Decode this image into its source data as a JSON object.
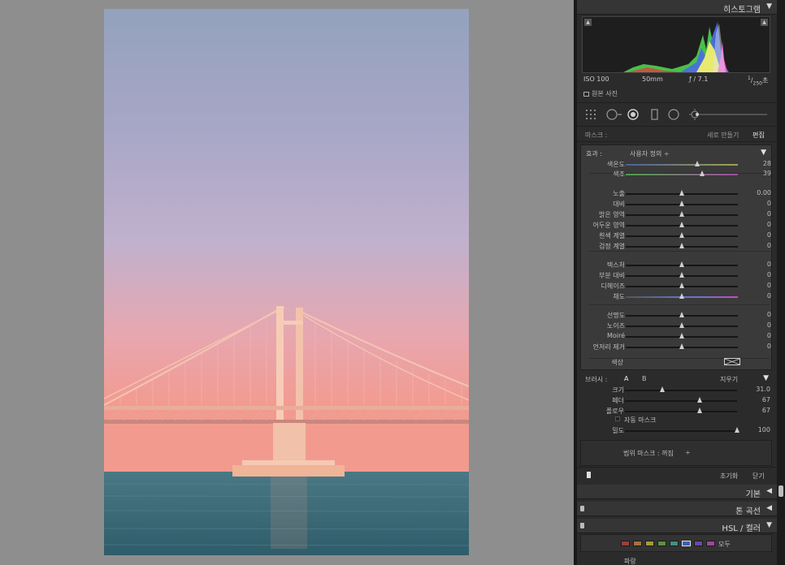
{
  "histogram": {
    "title": "히스토그램",
    "iso": "ISO 100",
    "focal": "50mm",
    "aperture": "ƒ / 7.1",
    "shutter_num": "1",
    "shutter_den": "250",
    "shutter_unit": "초",
    "original_photo": "원본 사진"
  },
  "mask": {
    "label": "마스크 :",
    "new_label": "새로 만들기",
    "edit_label": "편집"
  },
  "effect": {
    "label": "효과 :",
    "preset": "사용자 정의 ÷",
    "rows": [
      {
        "label": "색온도",
        "value": "28",
        "pos": 0.64
      },
      {
        "label": "색조",
        "value": "39",
        "pos": 0.68
      },
      {
        "label": "노출",
        "value": "0.00",
        "pos": 0.5
      },
      {
        "label": "대비",
        "value": "0",
        "pos": 0.5
      },
      {
        "label": "밝은 영역",
        "value": "0",
        "pos": 0.5
      },
      {
        "label": "어두운 영역",
        "value": "0",
        "pos": 0.5
      },
      {
        "label": "흰색 계열",
        "value": "0",
        "pos": 0.5
      },
      {
        "label": "검정 계열",
        "value": "0",
        "pos": 0.5
      },
      {
        "label": "텍스처",
        "value": "0",
        "pos": 0.5
      },
      {
        "label": "부분 대비",
        "value": "0",
        "pos": 0.5
      },
      {
        "label": "디헤이즈",
        "value": "0",
        "pos": 0.5
      },
      {
        "label": "채도",
        "value": "0",
        "pos": 0.5
      },
      {
        "label": "선명도",
        "value": "0",
        "pos": 0.5
      },
      {
        "label": "노이즈",
        "value": "0",
        "pos": 0.5
      },
      {
        "label": "Moiré",
        "value": "0",
        "pos": 0.5
      },
      {
        "label": "언저리 제거",
        "value": "0",
        "pos": 0.5
      }
    ],
    "color_label": "색상"
  },
  "brush": {
    "label": "브러시 :",
    "a": "A",
    "b": "B",
    "erase": "지우기",
    "rows": [
      {
        "label": "크기",
        "value": "31.0",
        "pos": 0.33
      },
      {
        "label": "페더",
        "value": "67",
        "pos": 0.67
      },
      {
        "label": "플로우",
        "value": "67",
        "pos": 0.67
      }
    ],
    "auto_mask": "자동 마스크",
    "density_label": "밀도",
    "density_value": "100",
    "density_pos": 1.0,
    "range_mask": "범위 마스크 : 꺼짐",
    "range_arrow": "÷",
    "reset": "초기화",
    "close": "닫기"
  },
  "panels": {
    "basic": "기본",
    "tone_curve": "톤 곡선",
    "hsl": "HSL / 컬러",
    "all": "모두",
    "blue": "파랑"
  },
  "hsl_swatches": [
    "#a43b3b",
    "#a8703a",
    "#a29a3a",
    "#5e8f3f",
    "#3f8f86",
    "#3c5fb3",
    "#6a49a8",
    "#a0479b"
  ],
  "colors": {
    "panel": "#2b2b2b",
    "effect_bg": "#3a3a3a",
    "canvas": "#8e8e8e"
  }
}
